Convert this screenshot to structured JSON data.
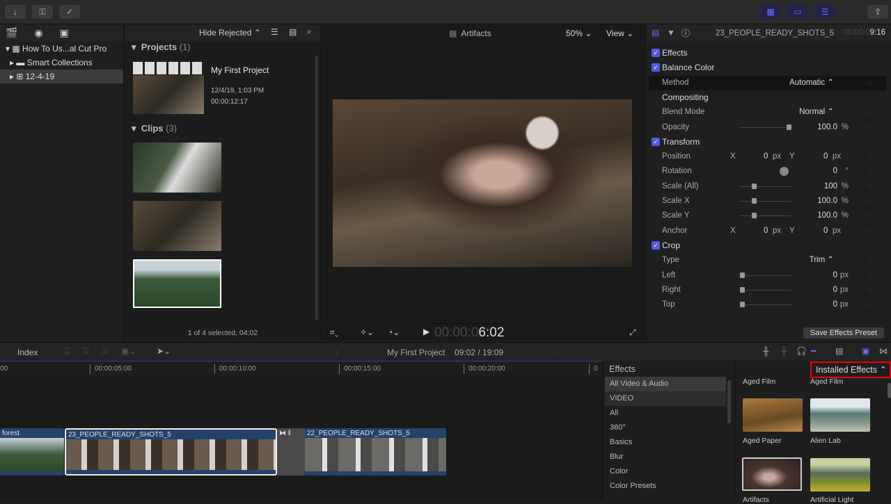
{
  "toolbar": {
    "import_icon": "↓",
    "keywords_icon": "⚿",
    "check_icon": "✓",
    "share_icon": "⇪"
  },
  "library": {
    "items": [
      {
        "label": "How To Us...al Cut Pro",
        "icon": "library-icon"
      },
      {
        "label": "Smart Collections",
        "icon": "folder-icon"
      },
      {
        "label": "12-4-19",
        "icon": "event-icon"
      }
    ]
  },
  "browser": {
    "filter": "Hide Rejected ⌃",
    "projects_label": "Projects",
    "projects_count": "(1)",
    "project": {
      "name": "My First Project",
      "date": "12/4/19, 1:03 PM",
      "duration": "00:00:12:17"
    },
    "clips_label": "Clips",
    "clips_count": "(3)",
    "status": "1 of 4 selected, 04:02"
  },
  "viewer": {
    "title": "Artifacts",
    "zoom": "50% ⌄",
    "view": "View ⌄",
    "timecode_dim": "00:00:0",
    "timecode": "6:02"
  },
  "inspector": {
    "clip_name": "23_PEOPLE_READY_SHOTS_5",
    "tc_dim": "00:00:0",
    "tc": "9:16",
    "save_preset": "Save Effects Preset",
    "rows": [
      {
        "type": "hdr",
        "label": "Effects",
        "check": true
      },
      {
        "type": "hdr",
        "label": "Balance Color",
        "check": true
      },
      {
        "label": "Method",
        "value": "Automatic ⌃"
      },
      {
        "type": "hdr",
        "label": "Compositing"
      },
      {
        "label": "Blend Mode",
        "value": "Normal ⌃"
      },
      {
        "label": "Opacity",
        "value": "100.0",
        "unit": "%",
        "slider": 0.97
      },
      {
        "type": "hdr",
        "label": "Transform",
        "check": true
      },
      {
        "label": "Position",
        "x": "0",
        "y": "0",
        "unit": "px"
      },
      {
        "label": "Rotation",
        "value": "0",
        "unit": "°"
      },
      {
        "label": "Scale (All)",
        "value": "100",
        "unit": "%",
        "slider": 0.25
      },
      {
        "label": "Scale X",
        "value": "100.0",
        "unit": "%",
        "slider": 0.25
      },
      {
        "label": "Scale Y",
        "value": "100.0",
        "unit": "%",
        "slider": 0.25
      },
      {
        "label": "Anchor",
        "x": "0",
        "y": "0",
        "unit": "px"
      },
      {
        "type": "hdr",
        "label": "Crop",
        "check": true
      },
      {
        "label": "Type",
        "value": "Trim ⌃"
      },
      {
        "label": "Left",
        "value": "0",
        "unit": "px",
        "slider": 0.02
      },
      {
        "label": "Right",
        "value": "0",
        "unit": "px",
        "slider": 0.02
      },
      {
        "label": "Top",
        "value": "0",
        "unit": "px",
        "slider": 0.02
      }
    ],
    "x_label": "X",
    "y_label": "Y"
  },
  "timeline": {
    "index": "Index",
    "project": "My First Project",
    "time": "09:02 / 19:09",
    "ruler": [
      "00",
      "00:00:05:00",
      "00:00:10:00",
      "00:00:15:00",
      "00:00:20:00",
      "0"
    ],
    "clips": [
      "forest",
      "23_PEOPLE_READY_SHOTS_5",
      "22_PEOPLE_READY_SHOTS_5"
    ]
  },
  "effects": {
    "title": "Effects",
    "dropdown": "Installed Effects ⌃",
    "categories": [
      "All Video & Audio",
      "VIDEO",
      "All",
      "360°",
      "Basics",
      "Blur",
      "Color",
      "Color Presets"
    ],
    "items": [
      "Aged Film",
      "Aged Film",
      "Aged Paper",
      "Alien Lab",
      "Artifacts",
      "Artificial Light"
    ]
  }
}
